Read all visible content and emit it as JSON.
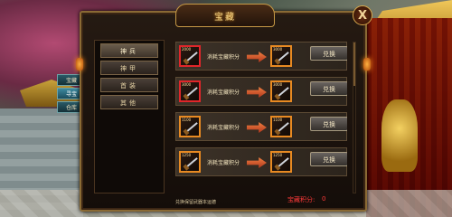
{
  "window": {
    "title": "宝藏",
    "close_label": "X"
  },
  "side_menu": {
    "items": [
      "宝藏",
      "寻宝",
      "仓库"
    ],
    "active_index": 1
  },
  "categories": {
    "items": [
      "神兵",
      "神甲",
      "首装",
      "其他"
    ],
    "active_index": 0
  },
  "rows": [
    {
      "from_level": "2000",
      "from_border": "red",
      "cost_label": "消耗宝藏积分",
      "to_level": "3000",
      "button_label": "兑换"
    },
    {
      "from_level": "3000",
      "from_border": "red",
      "cost_label": "消耗宝藏积分",
      "to_level": "3000",
      "button_label": "兑换"
    },
    {
      "from_level": "1100",
      "from_border": "orange",
      "cost_label": "消耗宝藏积分",
      "to_level": "1100",
      "button_label": "兑换"
    },
    {
      "from_level": "1250",
      "from_border": "orange",
      "cost_label": "消耗宝藏积分",
      "to_level": "1250",
      "button_label": "兑换"
    }
  ],
  "footer": {
    "hint": "兑换保留武器本运德",
    "points_label": "宝藏积分:",
    "points_value": "0"
  },
  "colors": {
    "accent_red": "#e0262a",
    "accent_orange": "#e88a22",
    "gold": "#c79a46"
  }
}
